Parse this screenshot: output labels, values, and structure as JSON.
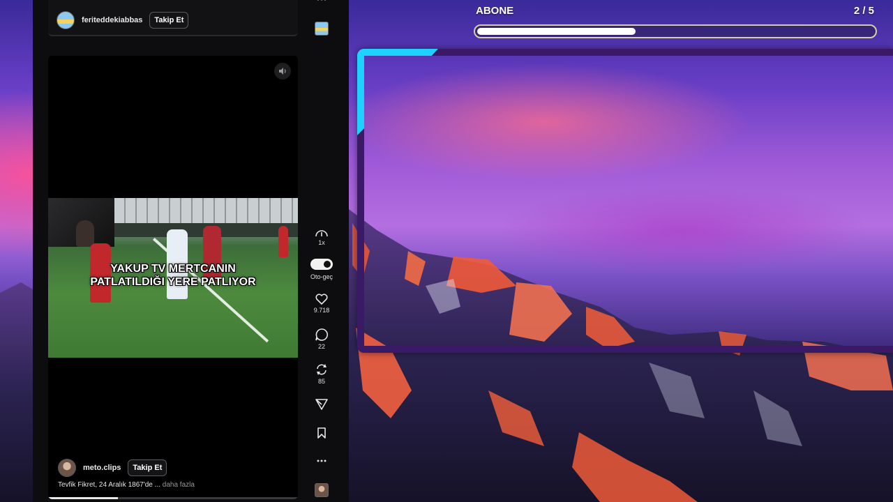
{
  "feed": {
    "top_post": {
      "username": "feriteddekiabbas",
      "follow_label": "Takip Et"
    },
    "video_post": {
      "username": "meto.clips",
      "follow_label": "Takip Et",
      "caption_line1": "YAKUP TV MERTCANIN",
      "caption_line2": "PATLATILDIĞI YERE PATLIYOR",
      "description": "Tevfik Fikret, 24 Aralık 1867'de ...",
      "more_label": "daha fazla",
      "progress": 0.28
    },
    "actions": {
      "speed_label": "1x",
      "autoplay_label": "Oto-geç",
      "likes": "9.718",
      "comments": "22",
      "reposts": "85"
    }
  },
  "goal": {
    "title": "ABONE",
    "count": "2 / 5",
    "progress": 0.4
  },
  "colors": {
    "frame_border": "#3a1a66",
    "frame_accent": "#1fd1ff",
    "goal_border": "#d8cfa8"
  },
  "icons": [
    "more-dots-icon",
    "volume-icon",
    "speed-gauge-icon",
    "autoplay-toggle-icon",
    "heart-icon",
    "comment-icon",
    "repost-icon",
    "share-icon",
    "bookmark-icon"
  ]
}
